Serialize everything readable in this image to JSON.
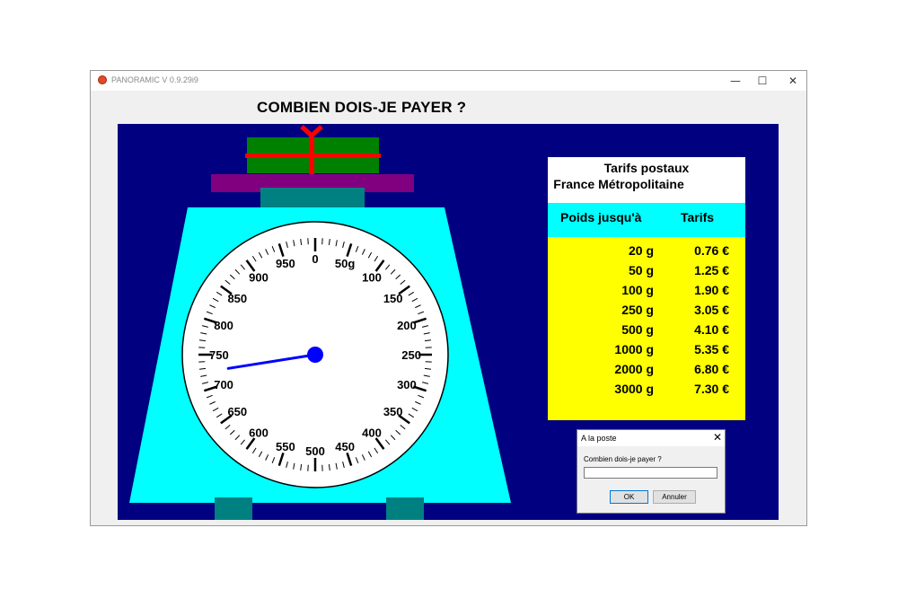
{
  "window": {
    "title": "PANORAMIC V 0.9.29i9",
    "minimize_glyph": "—",
    "maximize_glyph": "☐",
    "close_glyph": "✕"
  },
  "heading": "COMBIEN DOIS-JE PAYER ?",
  "scale": {
    "dial_labels": [
      "0",
      "50g",
      "100",
      "150",
      "200",
      "250",
      "300",
      "350",
      "400",
      "450",
      "500",
      "550",
      "600",
      "650",
      "700",
      "750",
      "800",
      "850",
      "900",
      "950"
    ],
    "pointer_value_g": 725,
    "max_value_g": 1000,
    "colors": {
      "background": "#000080",
      "body": "#00ffff",
      "platform": "#800080",
      "feet": "#008080",
      "package": "#008000",
      "ribbon": "#ff0000",
      "needle": "#0000ff"
    }
  },
  "tariffs": {
    "title_line1": "Tarifs postaux",
    "title_line2": "France Métropolitaine",
    "header_weight": "Poids jusqu'à",
    "header_price": "Tarifs",
    "rows": [
      {
        "weight": "20 g",
        "price": "0.76 €"
      },
      {
        "weight": "50 g",
        "price": "1.25 €"
      },
      {
        "weight": "100 g",
        "price": "1.90 €"
      },
      {
        "weight": "250 g",
        "price": "3.05 €"
      },
      {
        "weight": "500 g",
        "price": "4.10 €"
      },
      {
        "weight": "1000 g",
        "price": "5.35 €"
      },
      {
        "weight": "2000 g",
        "price": "6.80 €"
      },
      {
        "weight": "3000 g",
        "price": "7.30 €"
      }
    ],
    "colors": {
      "title_bg": "#ffffff",
      "header_bg": "#00ffff",
      "rows_bg": "#ffff00"
    }
  },
  "dialog": {
    "title": "A la poste",
    "close_glyph": "✕",
    "prompt": "Combien dois-je payer ?",
    "input_value": "",
    "ok_label": "OK",
    "cancel_label": "Annuler"
  }
}
